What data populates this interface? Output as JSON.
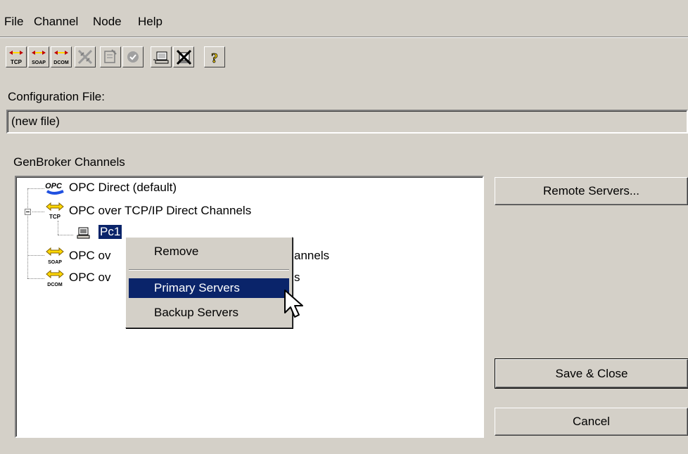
{
  "menu": {
    "file": "File",
    "channel": "Channel",
    "node": "Node",
    "help": "Help"
  },
  "toolbar": {
    "tcp_label": "TCP",
    "soap_label": "SOAP",
    "dcom_label": "DCOM",
    "help_glyph": "?"
  },
  "config": {
    "label": "Configuration File:",
    "value": "(new file)"
  },
  "channels": {
    "group_label": "GenBroker Channels",
    "opc_icon_text": "OPC",
    "items": [
      {
        "label": "OPC Direct (default)"
      },
      {
        "label": "OPC over TCP/IP Direct Channels",
        "icon_text": "TCP"
      },
      {
        "label": "Pc1"
      },
      {
        "label": "OPC ov",
        "tail": "annels",
        "icon_text": "SOAP"
      },
      {
        "label": "OPC ov",
        "tail": "s",
        "icon_text": "DCOM"
      }
    ]
  },
  "context_menu": {
    "remove": "Remove",
    "primary": "Primary Servers",
    "backup": "Backup Servers"
  },
  "buttons": {
    "remote_servers": "Remote Servers...",
    "save_close": "Save & Close",
    "cancel": "Cancel"
  },
  "colors": {
    "face": "#d4d0c8",
    "highlight": "#0a246a",
    "icon_yellow": "#ffd800"
  }
}
